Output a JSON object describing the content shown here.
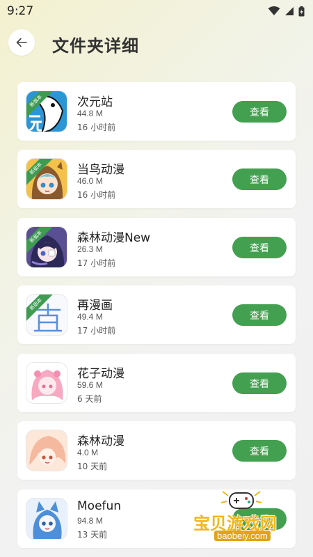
{
  "status_bar": {
    "time": "9:27"
  },
  "header": {
    "title": "文件夹详细",
    "back_icon": "arrow-left-icon"
  },
  "apps": [
    {
      "name": "次元站",
      "size": "44.8 M",
      "time": "16 小时前",
      "button": "查看",
      "badge": "新版本",
      "icon": "ciyuanzhan-logo"
    },
    {
      "name": "当鸟动漫",
      "size": "46.0 M",
      "time": "16 小时前",
      "button": "查看",
      "badge": "新版本",
      "icon": "dangniao-logo"
    },
    {
      "name": "森林动漫New",
      "size": "26.3 M",
      "time": "17 小时前",
      "button": "查看",
      "badge": "新版本",
      "icon": "senlin-new-logo"
    },
    {
      "name": "再漫画",
      "size": "49.4 M",
      "time": "17 小时前",
      "button": "查看",
      "badge": "新版本",
      "icon": "zaimanhua-logo"
    },
    {
      "name": "花子动漫",
      "size": "59.6 M",
      "time": "6 天前",
      "button": "查看",
      "badge": "",
      "icon": "huazi-logo"
    },
    {
      "name": "森林动漫",
      "size": "4.0 M",
      "time": "10 天前",
      "button": "查看",
      "badge": "",
      "icon": "senlin-logo"
    },
    {
      "name": "Moefun",
      "size": "94.8 M",
      "time": "13 天前",
      "button": "查看",
      "badge": "",
      "icon": "moefun-logo"
    }
  ],
  "watermark": {
    "text": "宝贝游戏网",
    "url": "baobeiy.com"
  },
  "colors": {
    "accent": "#43a050",
    "ribbon": "#3e9b52",
    "card": "#ffffff"
  }
}
